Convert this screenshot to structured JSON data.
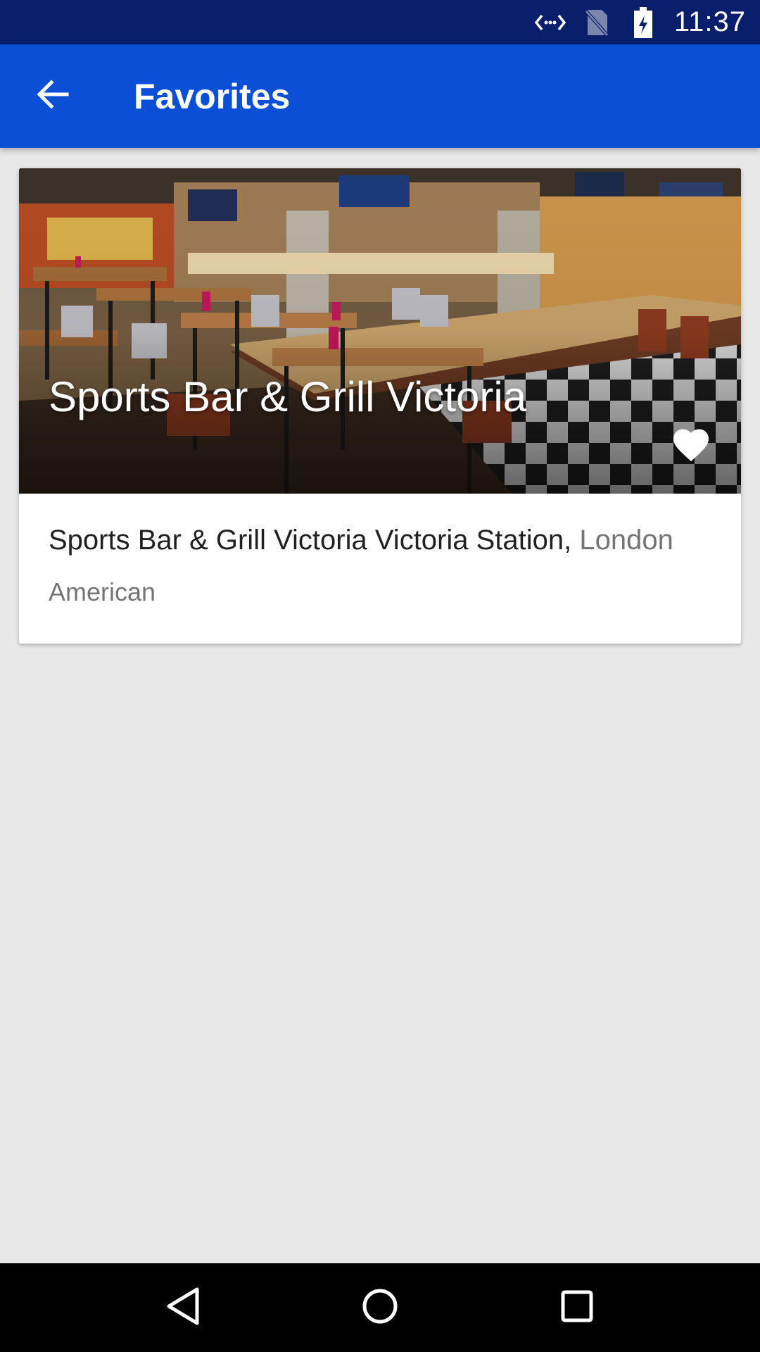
{
  "status_bar": {
    "time": "11:37",
    "icons": [
      "data-transfer-icon",
      "no-sim-icon",
      "battery-charging-icon"
    ]
  },
  "app_bar": {
    "title": "Favorites",
    "back_icon": "arrow-back-icon"
  },
  "favorites": [
    {
      "image_title": "Sports Bar & Grill Victoria",
      "name_line": "Sports Bar & Grill Victoria Victoria Station,",
      "city": "London",
      "cuisine": "American",
      "is_favorite": true,
      "favorite_icon": "heart-icon"
    }
  ],
  "nav_bar": {
    "icons": [
      "back-triangle-icon",
      "home-circle-icon",
      "recents-square-icon"
    ]
  },
  "colors": {
    "status_bar": "#0a1f6b",
    "app_bar": "#0a4fd6",
    "background": "#e8e8e8",
    "card": "#ffffff",
    "secondary_text": "#757575"
  }
}
